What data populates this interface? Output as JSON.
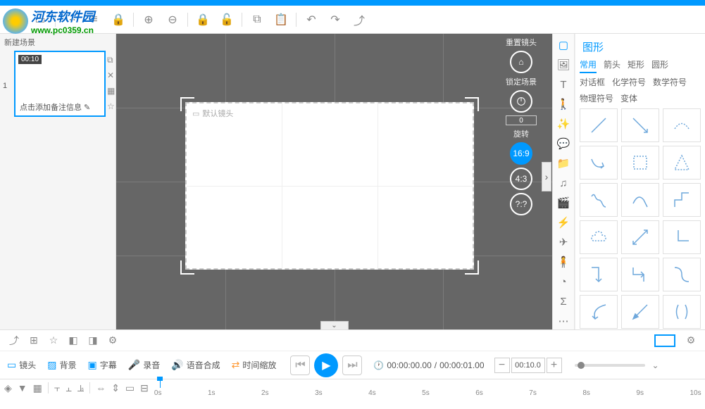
{
  "logo": {
    "text1": "河东软件园",
    "text2": "www.pc0359.cn"
  },
  "toolbar_top": {
    "tools": [
      "app-menu",
      "new",
      "save",
      "separator",
      "more",
      "text-tool",
      "lock",
      "separator",
      "zoom-in",
      "zoom-out",
      "separator",
      "lock-layer",
      "unlock-layer",
      "separator",
      "copy",
      "paste",
      "separator",
      "undo",
      "redo",
      "export"
    ]
  },
  "scene_panel": {
    "header_label": "新建场景",
    "thumbnail_time": "00:10",
    "scene_number": "1",
    "caption": "点击添加备注信息",
    "side_tools": [
      "copy",
      "delete",
      "grid",
      "star"
    ]
  },
  "canvas": {
    "stage_label": "默认镜头",
    "camera": {
      "reset_label": "重置镜头",
      "lock_label": "锁定场景",
      "rotate_label": "旋转",
      "rotate_value": "0",
      "ratios": [
        "16:9",
        "4:3",
        "?:?"
      ],
      "active_ratio": "16:9"
    }
  },
  "vert_toolbar": {
    "tools": [
      "select",
      "image",
      "text",
      "character",
      "fx",
      "comment",
      "folder",
      "music",
      "movie",
      "flash",
      "airplane",
      "person",
      "pie",
      "sigma",
      "more"
    ],
    "active": "select"
  },
  "shapes_panel": {
    "title": "图形",
    "tabs": [
      "常用",
      "箭头",
      "矩形",
      "圆形",
      "对话框",
      "化学符号",
      "数学符号",
      "物理符号",
      "变体"
    ],
    "active_tab": "常用"
  },
  "bottom_toolbar1": {
    "left_tools": [
      "export",
      "add-scene",
      "star",
      "align-l",
      "align-r",
      "filter"
    ]
  },
  "track_bar": {
    "buttons": [
      {
        "icon": "camera",
        "label": "镜头"
      },
      {
        "icon": "hatch",
        "label": "背景"
      },
      {
        "icon": "caption",
        "label": "字幕"
      },
      {
        "icon": "mic",
        "label": "录音"
      },
      {
        "icon": "tts",
        "label": "语音合成"
      },
      {
        "icon": "time",
        "label": "时间缩放",
        "orange": true
      }
    ],
    "time_current": "00:00:00.00",
    "time_total": "00:00:01.00",
    "zoom_value": "00:10.0"
  },
  "timeline": {
    "ticks": [
      "0s",
      "1s",
      "2s",
      "3s",
      "4s",
      "5s",
      "6s",
      "7s",
      "8s",
      "9s",
      "10s"
    ]
  }
}
